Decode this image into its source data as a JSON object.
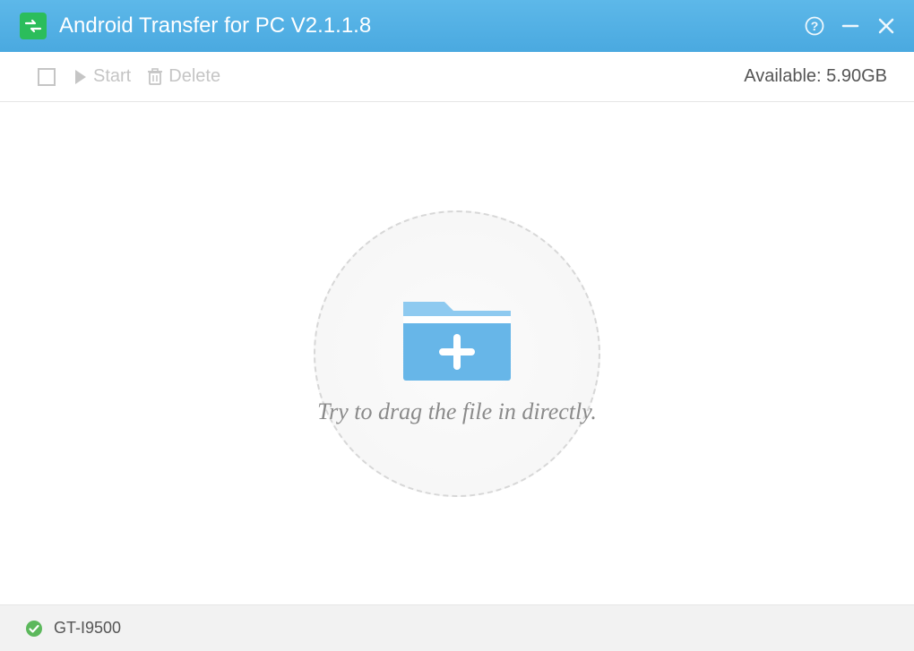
{
  "titlebar": {
    "title": "Android Transfer for PC V2.1.1.8"
  },
  "toolbar": {
    "start_label": "Start",
    "delete_label": "Delete",
    "available_label": "Available: 5.90GB"
  },
  "main": {
    "drop_hint": "Try to drag the file in directly."
  },
  "footer": {
    "device_name": "GT-I9500"
  }
}
